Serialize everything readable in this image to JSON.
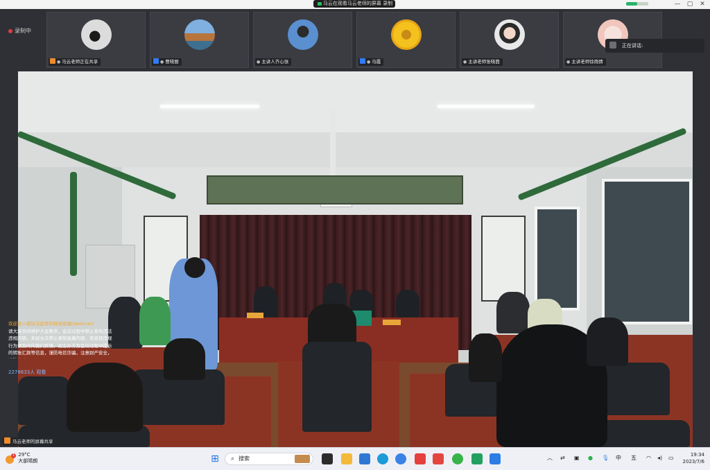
{
  "window": {
    "title": "马云在观看马云老师的屏幕 录制",
    "controls": [
      "—",
      "▢",
      "✕"
    ]
  },
  "recording_label": "录制中",
  "participants": [
    {
      "name": "马云老师正在共享",
      "role_color": "#f08c2b"
    },
    {
      "name": "曹晓丽",
      "role_color": "#2f7cf6"
    },
    {
      "name": "主讲人齐心张",
      "role_color": ""
    },
    {
      "name": "马霞",
      "role_color": "#2f7cf6"
    },
    {
      "name": "主讲老师张晓茜",
      "role_color": ""
    },
    {
      "name": "主讲老师徐雨倩",
      "role_color": ""
    }
  ],
  "speaking": {
    "label": "正在讲话:"
  },
  "subtitle": {
    "line1": "欢迎进入模拟法庭审判现场直播[Webinar]",
    "line2": "请大家共同维护大会秩序，会议过程中禁止发布违法违规内容，未经允许禁止录制直播内容，若发现违规行为请及时向我们反馈。如主办方及会议过程中提示的转账汇款等信息，谨防电信诈骗，注意财产安全，谨防诈骗！",
    "viewers": "2278633人 观看"
  },
  "share_status": "马云老师的屏幕共享",
  "taskbar": {
    "weather_temp": "29°C",
    "weather_desc": "大部晴朗",
    "weather_badge": "1",
    "search_placeholder": "搜索",
    "ime_lang": "中",
    "ime_mode": "五",
    "time": "19:34",
    "date": "2023/7/6"
  },
  "colors": {
    "meeting_bg": "#2e3035",
    "accent_orange": "#f08c2b",
    "accent_blue": "#2f7cf6",
    "taskbar_bg": "#eef0f5"
  }
}
